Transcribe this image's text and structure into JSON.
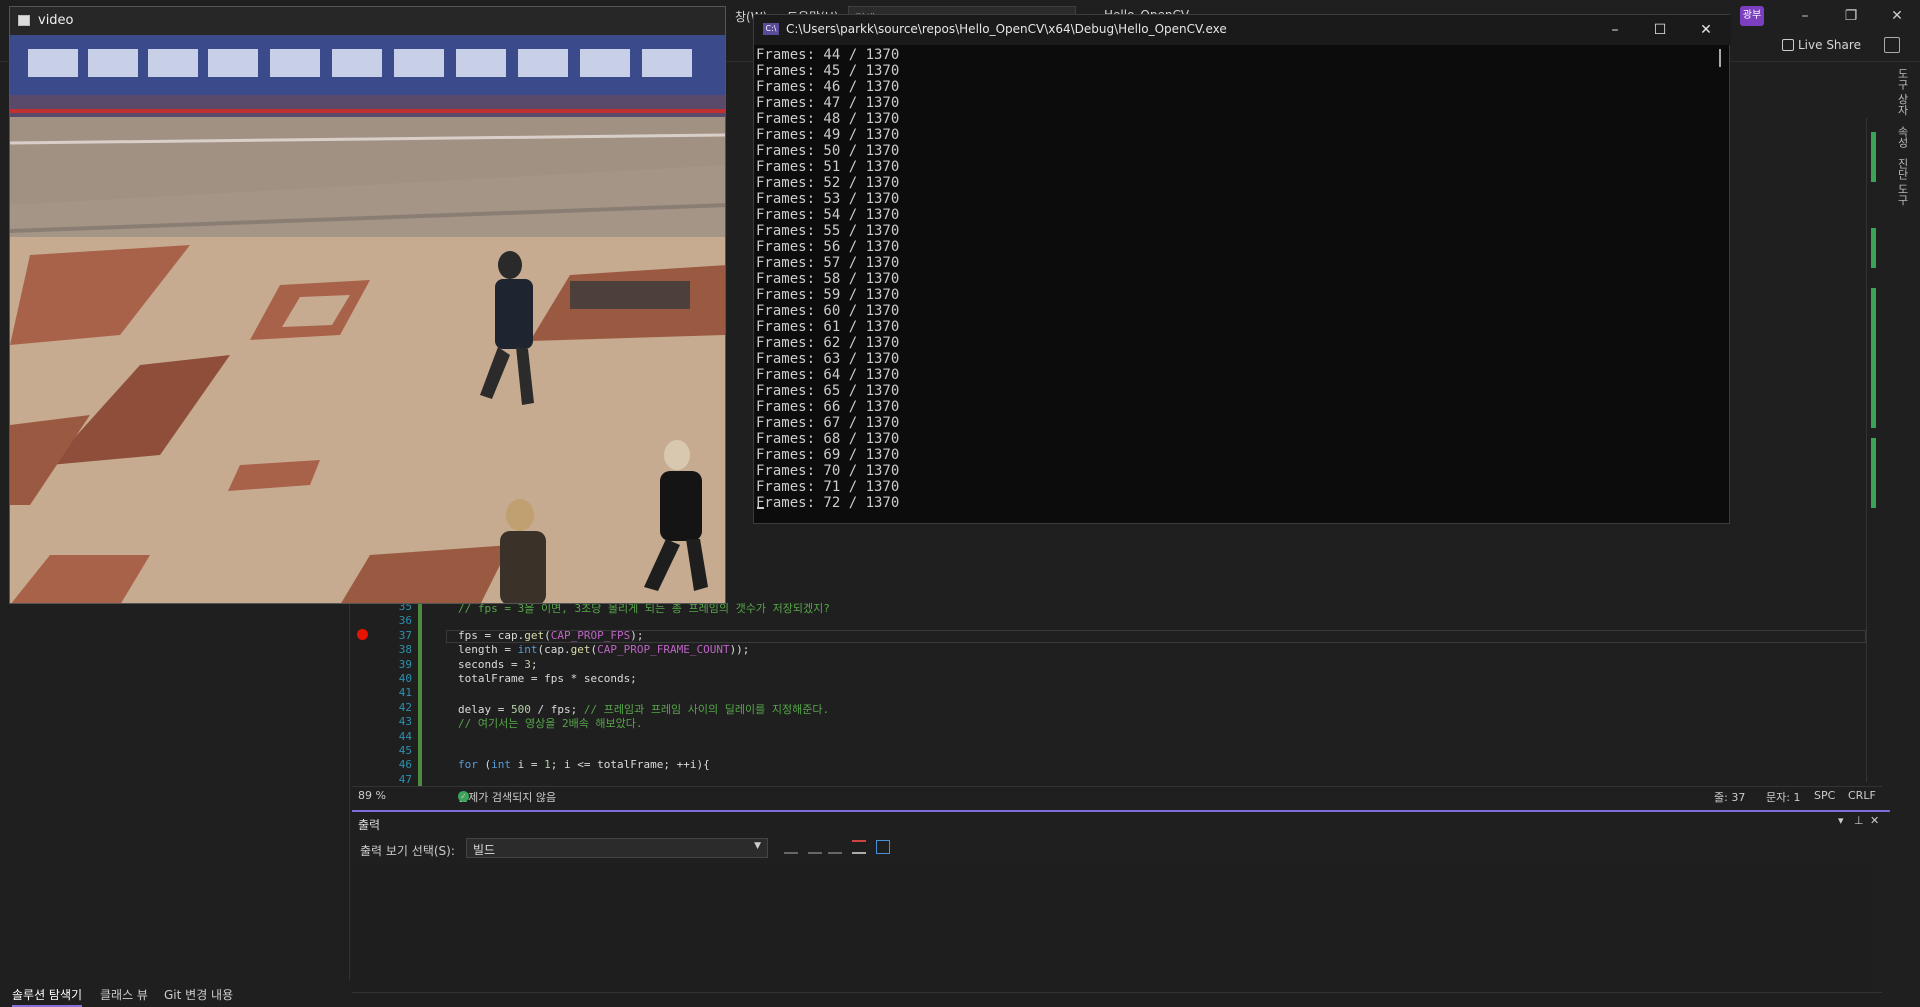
{
  "vs": {
    "menu": [
      "창(W)",
      "도움말(H)"
    ],
    "search_placeholder": "검색 (Ctrl+Q)",
    "solution_name": "Hello_OpenCV",
    "avatar": "광부",
    "live_share": "Live Share",
    "right_tabs": [
      "도구 상자",
      "속성",
      "진단 도구"
    ],
    "solution_tabs": [
      "솔루션 탐색기",
      "클래스 뷰",
      "Git 변경 내용"
    ]
  },
  "editor": {
    "lines": [
      {
        "n": "35",
        "segments": [
          {
            "c": "cm",
            "t": "// fps = 3을 이면, 3초당 몰리게 되는 총 프레임의 갯수가 저장되겠지?"
          }
        ]
      },
      {
        "n": "36",
        "segments": []
      },
      {
        "n": "37",
        "segments": [
          {
            "c": "",
            "t": "fps = cap."
          },
          {
            "c": "fn",
            "t": "get"
          },
          {
            "c": "",
            "t": "("
          },
          {
            "c": "mac",
            "t": "CAP_PROP_FPS"
          },
          {
            "c": "",
            "t": ");"
          }
        ]
      },
      {
        "n": "38",
        "segments": [
          {
            "c": "",
            "t": "length = "
          },
          {
            "c": "kw",
            "t": "int"
          },
          {
            "c": "",
            "t": "(cap."
          },
          {
            "c": "fn",
            "t": "get"
          },
          {
            "c": "",
            "t": "("
          },
          {
            "c": "mac",
            "t": "CAP_PROP_FRAME_COUNT"
          },
          {
            "c": "",
            "t": "));"
          }
        ]
      },
      {
        "n": "39",
        "segments": [
          {
            "c": "",
            "t": "seconds = "
          },
          {
            "c": "num",
            "t": "3"
          },
          {
            "c": "",
            "t": ";"
          }
        ]
      },
      {
        "n": "40",
        "segments": [
          {
            "c": "",
            "t": "totalFrame = fps * seconds;"
          }
        ]
      },
      {
        "n": "41",
        "segments": []
      },
      {
        "n": "42",
        "segments": [
          {
            "c": "",
            "t": "delay = "
          },
          {
            "c": "num",
            "t": "500"
          },
          {
            "c": "",
            "t": " / fps; "
          },
          {
            "c": "cm",
            "t": "// 프레임과 프레임 사이의 딜레이를 지정해준다."
          }
        ]
      },
      {
        "n": "43",
        "segments": [
          {
            "c": "cm",
            "t": "// 여기서는 영상을 2배속 해보았다."
          }
        ]
      },
      {
        "n": "44",
        "segments": []
      },
      {
        "n": "45",
        "segments": []
      },
      {
        "n": "46",
        "segments": [
          {
            "c": "kw",
            "t": "for"
          },
          {
            "c": "",
            "t": " ("
          },
          {
            "c": "kw",
            "t": "int"
          },
          {
            "c": "",
            "t": " i = "
          },
          {
            "c": "num",
            "t": "1"
          },
          {
            "c": "",
            "t": "; i <= totalFrame; ++i){"
          }
        ]
      },
      {
        "n": "47",
        "segments": []
      }
    ],
    "status": {
      "zoom": "89 %",
      "issues": "문제가 검색되지 않음",
      "line": "줄: 37",
      "col": "문자: 1",
      "whitespace": "SPC",
      "eol": "CRLF"
    }
  },
  "output": {
    "title": "출력",
    "source_label": "출력 보기 선택(S):",
    "source_value": "빌드"
  },
  "video_window": {
    "title": "video"
  },
  "console": {
    "title": "C:\\Users\\parkk\\source\\repos\\Hello_OpenCV\\x64\\Debug\\Hello_OpenCV.exe",
    "lines": [
      "Frames: 44 / 1370",
      "Frames: 45 / 1370",
      "Frames: 46 / 1370",
      "Frames: 47 / 1370",
      "Frames: 48 / 1370",
      "Frames: 49 / 1370",
      "Frames: 50 / 1370",
      "Frames: 51 / 1370",
      "Frames: 52 / 1370",
      "Frames: 53 / 1370",
      "Frames: 54 / 1370",
      "Frames: 55 / 1370",
      "Frames: 56 / 1370",
      "Frames: 57 / 1370",
      "Frames: 58 / 1370",
      "Frames: 59 / 1370",
      "Frames: 60 / 1370",
      "Frames: 61 / 1370",
      "Frames: 62 / 1370",
      "Frames: 63 / 1370",
      "Frames: 64 / 1370",
      "Frames: 65 / 1370",
      "Frames: 66 / 1370",
      "Frames: 67 / 1370",
      "Frames: 68 / 1370",
      "Frames: 69 / 1370",
      "Frames: 70 / 1370",
      "Frames: 71 / 1370",
      "Frames: 72 / 1370"
    ]
  }
}
